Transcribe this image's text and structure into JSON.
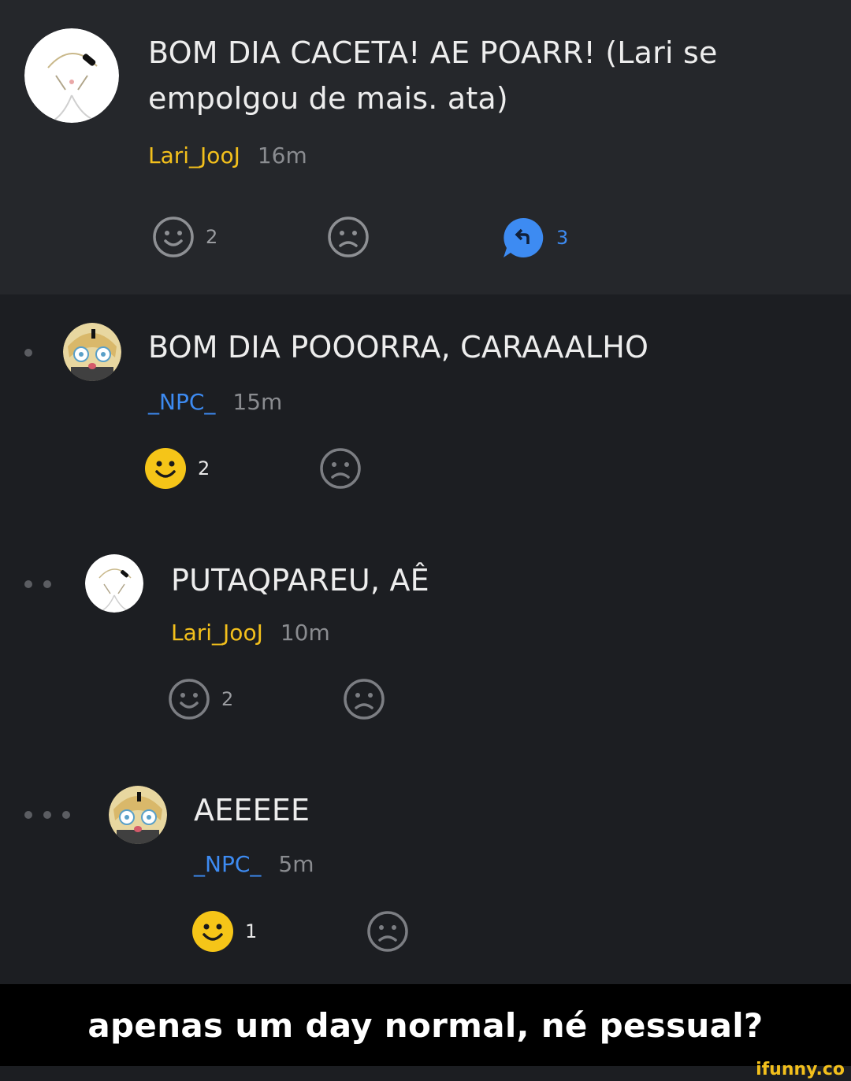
{
  "comments": [
    {
      "text": "BOM DIA CACETA! AE POARR! (Lari se empolgou de mais. ata)",
      "username": "Lari_JooJ",
      "time": "16m",
      "likes": "2",
      "replies": "3"
    },
    {
      "text": "BOM DIA POOORRA, CARAAALHO",
      "username": "_NPC_",
      "time": "15m",
      "likes": "2"
    },
    {
      "text": "PUTAQPAREU, AÊ",
      "username": "Lari_JooJ",
      "time": "10m",
      "likes": "2"
    },
    {
      "text": "AEEEEE",
      "username": "_NPC_",
      "time": "5m",
      "likes": "1"
    }
  ],
  "caption": "apenas um day normal, né pessual?",
  "watermark": "ifunny.co",
  "colors": {
    "username_lari": "#f3c01c",
    "username_npc": "#3d8bf2",
    "liked_smiley": "#f5c518",
    "reply_bubble": "#3d8bf2"
  }
}
